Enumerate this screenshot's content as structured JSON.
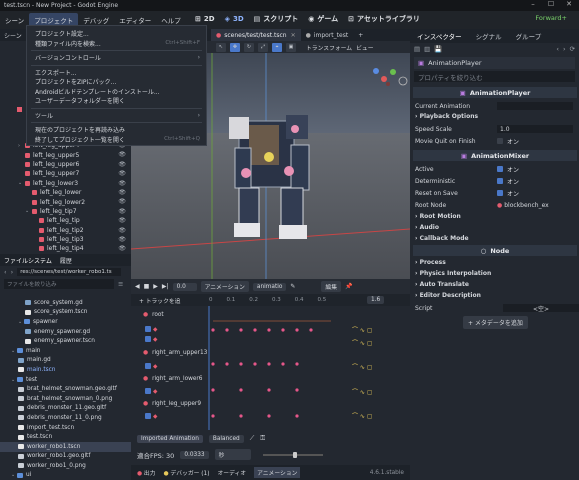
{
  "titlebar": {
    "title": "test.tscn - New Project - Godot Engine"
  },
  "menu": {
    "items": [
      "シーン",
      "プロジェクト",
      "デバッグ",
      "エディター",
      "ヘルプ"
    ],
    "active_index": 1
  },
  "workspaces": [
    "2D",
    "3D",
    "スクリプト",
    "ゲーム",
    "アセットライブラリ"
  ],
  "renderer": "Forward+",
  "dropdown": {
    "items": [
      {
        "label": "プロジェクト設定...",
        "shortcut": ""
      },
      {
        "label": "種類ファイル内を検索...",
        "shortcut": "Ctrl+Shift+F"
      },
      {
        "sep": true
      },
      {
        "label": "バージョンコントロール",
        "shortcut": "",
        "submenu": true
      },
      {
        "sep": true
      },
      {
        "label": "エクスポート...",
        "shortcut": ""
      },
      {
        "label": "プロジェクトをZIPにパック...",
        "shortcut": ""
      },
      {
        "label": "Androidビルドテンプレートのインストール...",
        "shortcut": ""
      },
      {
        "label": "ユーザーデータフォルダーを開く",
        "shortcut": ""
      },
      {
        "sep": true
      },
      {
        "label": "ツール",
        "shortcut": "",
        "submenu": true
      },
      {
        "sep": true
      },
      {
        "label": "現在のプロジェクトを再読み込み",
        "shortcut": ""
      },
      {
        "label": "終了してプロジェクト一覧を開く",
        "shortcut": "Ctrl+Shift+Q"
      }
    ]
  },
  "scene_dock": {
    "title": "シーン",
    "nodes": [
      "left_leg_upper4",
      "left_leg_upper5",
      "left_leg_upper6",
      "left_leg_upper7",
      "left_leg_lower3",
      "left_leg_lower",
      "left_leg_lower2",
      "left_leg_tip7",
      "left_leg_tip",
      "left_leg_tip2",
      "left_leg_tip3",
      "left_leg_tip4"
    ]
  },
  "filesystem": {
    "tabs": [
      "ファイルシステム",
      "履歴"
    ],
    "path": "res://scenes/test/worker_robo1.ts",
    "filter_placeholder": "ファイルを絞り込み",
    "rows": [
      {
        "name": "score_system.gd",
        "type": "gd",
        "indent": 3
      },
      {
        "name": "score_system.tscn",
        "type": "scene",
        "indent": 3
      },
      {
        "name": "spawner",
        "type": "folder",
        "indent": 2
      },
      {
        "name": "enemy_spawner.gd",
        "type": "gd",
        "indent": 3
      },
      {
        "name": "enemy_spawner.tscn",
        "type": "scene",
        "indent": 3
      },
      {
        "name": "main",
        "type": "folder",
        "indent": 1
      },
      {
        "name": "main.gd",
        "type": "gd",
        "indent": 2
      },
      {
        "name": "main.tscn",
        "type": "scene",
        "indent": 2,
        "highlight": true
      },
      {
        "name": "test",
        "type": "folder",
        "indent": 1
      },
      {
        "name": "brat_helmet_snowman.geo.gltf",
        "type": "file",
        "indent": 2
      },
      {
        "name": "brat_helmet_snowman_0.png",
        "type": "file",
        "indent": 2
      },
      {
        "name": "debris_monster_11.geo.gltf",
        "type": "file",
        "indent": 2
      },
      {
        "name": "debris_monster_11_0.png",
        "type": "file",
        "indent": 2
      },
      {
        "name": "import_test.tscn",
        "type": "scene",
        "indent": 2
      },
      {
        "name": "test.tscn",
        "type": "scene",
        "indent": 2
      },
      {
        "name": "worker_robo1.tscn",
        "type": "scene",
        "indent": 2,
        "selected": true
      },
      {
        "name": "worker_robo1.geo.gltf",
        "type": "file",
        "indent": 2
      },
      {
        "name": "worker_robo1_0.png",
        "type": "file",
        "indent": 2
      },
      {
        "name": "ui",
        "type": "folder",
        "indent": 1
      }
    ]
  },
  "viewport": {
    "tabs": [
      "scenes/test/test.tscn",
      "import_test"
    ],
    "transform_label": "トランスフォーム",
    "view_label": "ビュー"
  },
  "animation": {
    "time": "0.0",
    "anim_label": "アニメーション",
    "anim_name": "animatio",
    "edit_label": "編集",
    "length": "1.6",
    "add_track_label": "+ トラックを追",
    "timeline_ticks": [
      "0",
      "0.1",
      "0.2",
      "0.3",
      "0.4",
      "0.5"
    ],
    "tracks": [
      "root",
      "right_arm_upper13",
      "right_arm_lower6",
      "right_leg_upper9"
    ],
    "imported_label": "Imported Animation",
    "balanced_label": "Balanced",
    "fps_label": "適合FPS: 30",
    "step_value": "0.0333",
    "step_unit": "秒"
  },
  "bottom_tabs": {
    "output": "出力",
    "debugger": "デバッガー (1)",
    "audio": "オーディオ",
    "animation": "アニメーション",
    "version": "4.6.1.stable"
  },
  "inspector": {
    "tabs": [
      "インスペクター",
      "シグナル",
      "グループ"
    ],
    "node_name": "AnimationPlayer",
    "filter_placeholder": "プロパティを絞り込む",
    "anim_player_header": "AnimationPlayer",
    "current_animation_label": "Current Animation",
    "playback_options_label": "Playback Options",
    "speed_scale_label": "Speed Scale",
    "speed_scale_value": "1.0",
    "movie_quit_label": "Movie Quit on Finish",
    "movie_quit_value": "オン",
    "anim_mixer_header": "AnimationMixer",
    "active_label": "Active",
    "active_value": "オン",
    "deterministic_label": "Deterministic",
    "deterministic_value": "オン",
    "reset_on_save_label": "Reset on Save",
    "reset_on_save_value": "オン",
    "root_node_label": "Root Node",
    "root_node_value": "blockbench_ex",
    "groups1": [
      "Root Motion",
      "Audio",
      "Callback Mode"
    ],
    "node_header": "Node",
    "groups2": [
      "Process",
      "Physics Interpolation",
      "Auto Translate",
      "Editor Description"
    ],
    "script_label": "Script",
    "script_value": "<空>",
    "add_metadata_label": "+ メタデータを追加"
  }
}
